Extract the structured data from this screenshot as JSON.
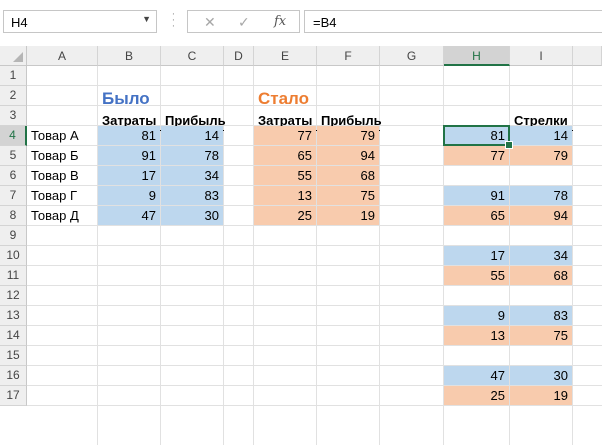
{
  "formula_bar": {
    "name_box": "H4",
    "formula": "=B4",
    "cancel_icon": "x-icon",
    "enter_icon": "check-icon",
    "function_icon": "fx-icon"
  },
  "grid": {
    "columns": [
      "A",
      "B",
      "C",
      "D",
      "E",
      "F",
      "G",
      "H",
      "I"
    ],
    "rows": [
      "1",
      "2",
      "3",
      "4",
      "5",
      "6",
      "7",
      "8",
      "9",
      "10",
      "11",
      "12",
      "13",
      "14",
      "15",
      "16",
      "17"
    ],
    "active_cell": "H4"
  },
  "before": {
    "title": "Было",
    "header_cost": "Затраты",
    "header_profit": "Прибыль",
    "products": [
      "Товар А",
      "Товар Б",
      "Товар В",
      "Товар Г",
      "Товар Д"
    ],
    "cost": [
      "81",
      "91",
      "17",
      "9",
      "47"
    ],
    "profit": [
      "14",
      "78",
      "34",
      "83",
      "30"
    ]
  },
  "after": {
    "title": "Стало",
    "header_cost": "Затраты",
    "header_profit": "Прибыль",
    "cost": [
      "77",
      "65",
      "55",
      "13",
      "25"
    ],
    "profit": [
      "79",
      "94",
      "68",
      "75",
      "19"
    ]
  },
  "arrows": {
    "header": "Стрелки",
    "pairs": [
      {
        "h_before": "81",
        "i_before": "14",
        "h_after": "77",
        "i_after": "79"
      },
      {
        "h_before": "91",
        "i_before": "78",
        "h_after": "65",
        "i_after": "94"
      },
      {
        "h_before": "17",
        "i_before": "34",
        "h_after": "55",
        "i_after": "68"
      },
      {
        "h_before": "9",
        "i_before": "83",
        "h_after": "13",
        "i_after": "75"
      },
      {
        "h_before": "47",
        "i_before": "30",
        "h_after": "25",
        "i_after": "19"
      }
    ]
  },
  "colors": {
    "before_fill": "#bdd7ee",
    "after_fill": "#f8cbad",
    "before_title": "#4472c4",
    "after_title": "#ed7d31",
    "selection": "#217346"
  }
}
